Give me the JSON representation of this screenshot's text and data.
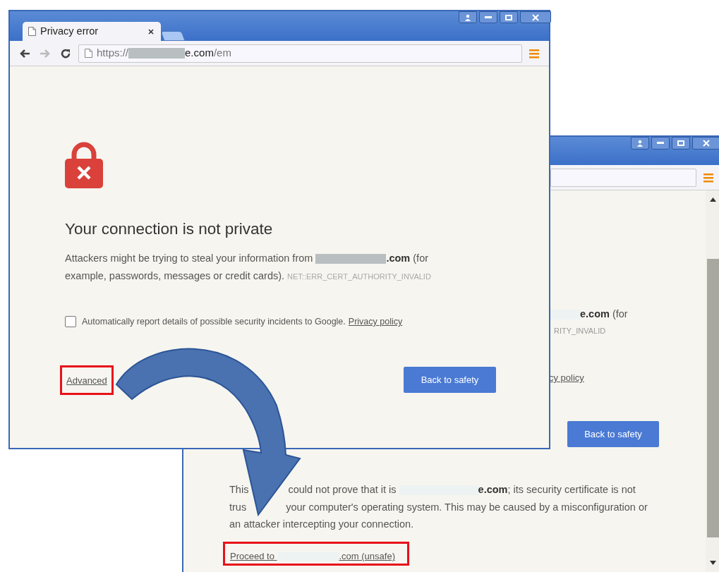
{
  "back_window": {
    "message_tail": [
      {
        "kind": "redacted"
      },
      {
        "kind": "bold",
        "text": "e.com"
      },
      {
        "kind": "text",
        "text": " (for"
      }
    ],
    "error_code_tail": "RITY_INVALID",
    "link_tail": "cy policy",
    "primary_button": "Back to safety",
    "details": [
      [
        {
          "kind": "text",
          "text": "This"
        },
        {
          "kind": "covered"
        },
        {
          "kind": "text",
          "text": "could not prove that it is "
        },
        {
          "kind": "redacted"
        },
        {
          "kind": "bold",
          "text": "e.com"
        },
        {
          "kind": "text",
          "text": "; its security certificate is not"
        }
      ],
      [
        {
          "kind": "text",
          "text": "trus"
        },
        {
          "kind": "covered"
        },
        {
          "kind": "text",
          "text": "your computer's operating system. This may be caused by a misconfiguration or"
        }
      ],
      [
        {
          "kind": "text",
          "text": "an attacker intercepting your connection."
        }
      ]
    ],
    "proceed_link": [
      {
        "kind": "text",
        "text": "Proceed to "
      },
      {
        "kind": "redacted"
      },
      {
        "kind": "text",
        "text": ".com (unsafe)"
      }
    ],
    "proceed_highlighted": true
  },
  "front_window": {
    "tab_title": "Privacy error",
    "url": [
      {
        "kind": "text",
        "text": "https://"
      },
      {
        "kind": "redacted"
      },
      {
        "kind": "host",
        "text": "e.com"
      },
      {
        "kind": "text",
        "text": "/em"
      }
    ],
    "heading": "Your connection is not private",
    "message": [
      {
        "kind": "text",
        "text": "Attackers might be trying to steal your information from "
      },
      {
        "kind": "redacted"
      },
      {
        "kind": "bold",
        "text": ".com"
      },
      {
        "kind": "text",
        "text": " (for example, passwords, messages or credit cards). "
      },
      {
        "kind": "code",
        "text": "NET::ERR_CERT_AUTHORITY_INVALID"
      }
    ],
    "checkbox": {
      "label": "Automatically report details of possible security incidents to Google.",
      "link": "Privacy policy",
      "checked": false
    },
    "advanced_link": "Advanced",
    "advanced_highlighted": true,
    "primary_button": "Back to safety"
  }
}
